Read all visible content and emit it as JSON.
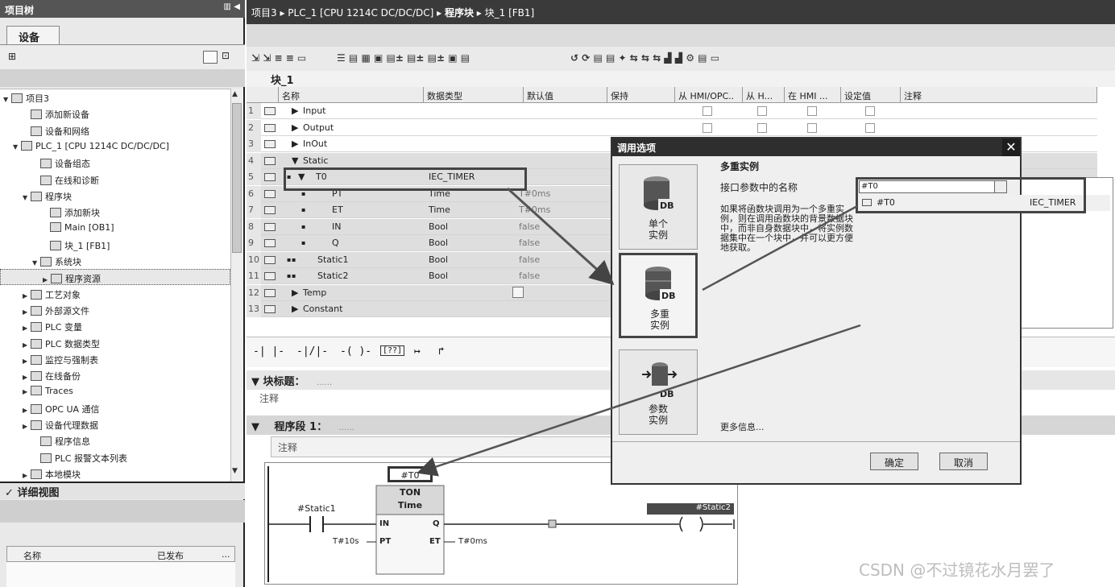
{
  "left_panel": {
    "title": "项目树",
    "tab": "设备",
    "tree": [
      {
        "label": "项目3",
        "level": 0,
        "toggle": "▼"
      },
      {
        "label": "添加新设备",
        "level": 2,
        "toggle": ""
      },
      {
        "label": "设备和网络",
        "level": 2,
        "toggle": ""
      },
      {
        "label": "PLC_1 [CPU 1214C DC/DC/DC]",
        "level": 1,
        "toggle": "▼"
      },
      {
        "label": "设备组态",
        "level": 3,
        "toggle": ""
      },
      {
        "label": "在线和诊断",
        "level": 3,
        "toggle": ""
      },
      {
        "label": "程序块",
        "level": 2,
        "toggle": "▼"
      },
      {
        "label": "添加新块",
        "level": 4,
        "toggle": ""
      },
      {
        "label": "Main [OB1]",
        "level": 4,
        "toggle": ""
      },
      {
        "label": "块_1 [FB1]",
        "level": 4,
        "toggle": ""
      },
      {
        "label": "系统块",
        "level": 3,
        "toggle": "▼"
      },
      {
        "label": "程序资源",
        "level": 4,
        "toggle": "▶",
        "selected": true
      },
      {
        "label": "工艺对象",
        "level": 2,
        "toggle": "▶"
      },
      {
        "label": "外部源文件",
        "level": 2,
        "toggle": "▶"
      },
      {
        "label": "PLC 变量",
        "level": 2,
        "toggle": "▶"
      },
      {
        "label": "PLC 数据类型",
        "level": 2,
        "toggle": "▶"
      },
      {
        "label": "监控与强制表",
        "level": 2,
        "toggle": "▶"
      },
      {
        "label": "在线备份",
        "level": 2,
        "toggle": "▶"
      },
      {
        "label": "Traces",
        "level": 2,
        "toggle": "▶"
      },
      {
        "label": "OPC UA 通信",
        "level": 2,
        "toggle": "▶"
      },
      {
        "label": "设备代理数据",
        "level": 2,
        "toggle": "▶"
      },
      {
        "label": "程序信息",
        "level": 3,
        "toggle": ""
      },
      {
        "label": "PLC 报警文本列表",
        "level": 3,
        "toggle": ""
      },
      {
        "label": "本地模块",
        "level": 2,
        "toggle": "▶"
      }
    ],
    "detail_title": "详细视图",
    "detail_cols": [
      "名称",
      "已发布",
      "..."
    ]
  },
  "breadcrumb": [
    "项目3",
    "PLC_1 [CPU 1214C DC/DC/DC]",
    "程序块",
    "块_1 [FB1]"
  ],
  "block_name": "块_1",
  "table": {
    "headers": [
      "名称",
      "数据类型",
      "默认值",
      "保持",
      "从 HMI/OPC..",
      "从 H...",
      "在 HMI ...",
      "设定值",
      "注释"
    ],
    "rows": [
      {
        "num": "1",
        "toggle": "▶",
        "name": "Input",
        "type": "",
        "default": "",
        "checks": true
      },
      {
        "num": "2",
        "toggle": "▶",
        "name": "Output",
        "type": "",
        "default": "",
        "checks": true
      },
      {
        "num": "3",
        "toggle": "▶",
        "name": "InOut",
        "type": "",
        "default": "",
        "checks": true
      },
      {
        "num": "4",
        "toggle": "▼",
        "name": "Static",
        "type": "",
        "default": "",
        "checks": false
      },
      {
        "num": "5",
        "toggle": "▼",
        "name": "T0",
        "type": "IEC_TIMER",
        "default": "",
        "checks": false
      },
      {
        "num": "6",
        "toggle": "",
        "name": "PT",
        "type": "Time",
        "default": "T#0ms",
        "checks": false
      },
      {
        "num": "7",
        "toggle": "",
        "name": "ET",
        "type": "Time",
        "default": "T#0ms",
        "checks": false
      },
      {
        "num": "8",
        "toggle": "",
        "name": "IN",
        "type": "Bool",
        "default": "false",
        "checks": false
      },
      {
        "num": "9",
        "toggle": "",
        "name": "Q",
        "type": "Bool",
        "default": "false",
        "checks": false
      },
      {
        "num": "10",
        "toggle": "",
        "name": "Static1",
        "type": "Bool",
        "default": "false",
        "checks": false
      },
      {
        "num": "11",
        "toggle": "",
        "name": "Static2",
        "type": "Bool",
        "default": "false",
        "checks": false
      },
      {
        "num": "12",
        "toggle": "▶",
        "name": "Temp",
        "type": "",
        "default": "",
        "checks": false
      },
      {
        "num": "13",
        "toggle": "▶",
        "name": "Constant",
        "type": "",
        "default": "",
        "checks": false
      }
    ]
  },
  "ladder_toolbar": [
    "-|  |-",
    "-|/|-",
    "-( )-",
    "[??]",
    "↦",
    "↱"
  ],
  "block_title": "块标题：",
  "block_title_dots": "......",
  "comment_label": "注释",
  "network_title": "程序段 1：",
  "network_dots": "......",
  "network_comment": "注释",
  "ladder": {
    "instance": "#T0",
    "box_type": "TON",
    "box_sub": "Time",
    "contact": "#Static1",
    "coil": "#Static2",
    "pin_in": "IN",
    "pin_pt": "PT",
    "pin_q": "Q",
    "pin_et": "ET",
    "pt_value": "T#10s",
    "et_value": "T#0ms"
  },
  "dialog": {
    "title": "调用选项",
    "options": [
      {
        "label1": "单个",
        "label2": "实例"
      },
      {
        "label1": "多重",
        "label2": "实例"
      },
      {
        "label1": "参数",
        "label2": "实例"
      }
    ],
    "heading": "多重实例",
    "field_label": "接口参数中的名称",
    "field_value": "#T0",
    "description": "如果将函数块调用为一个多重实例，则在调用函数块的背景数据块中，而非自身数据块中，将实例数据集中在一个块中，并可以更方便地获取。",
    "more_info": "更多信息...",
    "ok": "确定",
    "cancel": "取消",
    "dropdown_item_name": "#T0",
    "dropdown_item_type": "IEC_TIMER"
  },
  "watermark": "CSDN @不过镜花水月罢了"
}
